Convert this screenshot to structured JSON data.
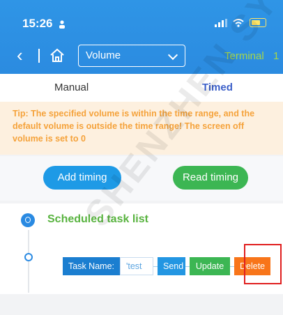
{
  "status_bar": {
    "time": "15:26"
  },
  "nav": {
    "select_value": "Volume",
    "terminal_label": "Terminal",
    "terminal_num": "1"
  },
  "tabs": [
    {
      "label": "Manual"
    },
    {
      "label": "Timed"
    }
  ],
  "tip": "Tip: The specified volume is within the time range, and the default volume is outside the time range! The screen off volume is set to 0",
  "actions": {
    "add_timing": "Add timing",
    "read_timing": "Read timing"
  },
  "task_list": {
    "title": "Scheduled task list",
    "task": {
      "name_label": "Task Name:",
      "name_value": "'test",
      "send": "Send",
      "update": "Update",
      "delete": "Delete"
    }
  },
  "watermark": "SHENZHEN SYSOLUTION",
  "colors": {
    "header": "#2f95e6",
    "accent_green": "#3cb653",
    "accent_orange": "#f8751a",
    "tip_text": "#f5a23a"
  }
}
